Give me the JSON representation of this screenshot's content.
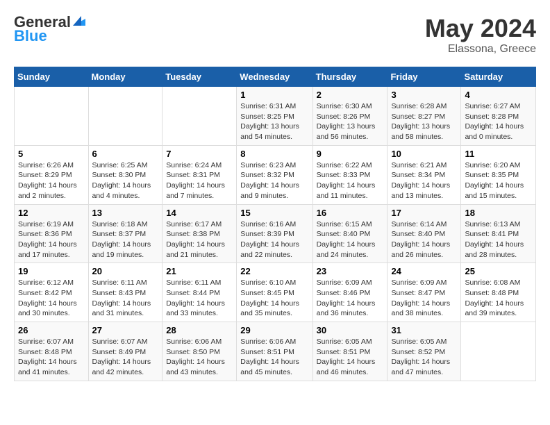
{
  "header": {
    "logo_line1": "General",
    "logo_line2": "Blue",
    "month": "May 2024",
    "location": "Elassona, Greece"
  },
  "weekdays": [
    "Sunday",
    "Monday",
    "Tuesday",
    "Wednesday",
    "Thursday",
    "Friday",
    "Saturday"
  ],
  "weeks": [
    [
      {
        "day": "",
        "info": ""
      },
      {
        "day": "",
        "info": ""
      },
      {
        "day": "",
        "info": ""
      },
      {
        "day": "1",
        "info": "Sunrise: 6:31 AM\nSunset: 8:25 PM\nDaylight: 13 hours\nand 54 minutes."
      },
      {
        "day": "2",
        "info": "Sunrise: 6:30 AM\nSunset: 8:26 PM\nDaylight: 13 hours\nand 56 minutes."
      },
      {
        "day": "3",
        "info": "Sunrise: 6:28 AM\nSunset: 8:27 PM\nDaylight: 13 hours\nand 58 minutes."
      },
      {
        "day": "4",
        "info": "Sunrise: 6:27 AM\nSunset: 8:28 PM\nDaylight: 14 hours\nand 0 minutes."
      }
    ],
    [
      {
        "day": "5",
        "info": "Sunrise: 6:26 AM\nSunset: 8:29 PM\nDaylight: 14 hours\nand 2 minutes."
      },
      {
        "day": "6",
        "info": "Sunrise: 6:25 AM\nSunset: 8:30 PM\nDaylight: 14 hours\nand 4 minutes."
      },
      {
        "day": "7",
        "info": "Sunrise: 6:24 AM\nSunset: 8:31 PM\nDaylight: 14 hours\nand 7 minutes."
      },
      {
        "day": "8",
        "info": "Sunrise: 6:23 AM\nSunset: 8:32 PM\nDaylight: 14 hours\nand 9 minutes."
      },
      {
        "day": "9",
        "info": "Sunrise: 6:22 AM\nSunset: 8:33 PM\nDaylight: 14 hours\nand 11 minutes."
      },
      {
        "day": "10",
        "info": "Sunrise: 6:21 AM\nSunset: 8:34 PM\nDaylight: 14 hours\nand 13 minutes."
      },
      {
        "day": "11",
        "info": "Sunrise: 6:20 AM\nSunset: 8:35 PM\nDaylight: 14 hours\nand 15 minutes."
      }
    ],
    [
      {
        "day": "12",
        "info": "Sunrise: 6:19 AM\nSunset: 8:36 PM\nDaylight: 14 hours\nand 17 minutes."
      },
      {
        "day": "13",
        "info": "Sunrise: 6:18 AM\nSunset: 8:37 PM\nDaylight: 14 hours\nand 19 minutes."
      },
      {
        "day": "14",
        "info": "Sunrise: 6:17 AM\nSunset: 8:38 PM\nDaylight: 14 hours\nand 21 minutes."
      },
      {
        "day": "15",
        "info": "Sunrise: 6:16 AM\nSunset: 8:39 PM\nDaylight: 14 hours\nand 22 minutes."
      },
      {
        "day": "16",
        "info": "Sunrise: 6:15 AM\nSunset: 8:40 PM\nDaylight: 14 hours\nand 24 minutes."
      },
      {
        "day": "17",
        "info": "Sunrise: 6:14 AM\nSunset: 8:40 PM\nDaylight: 14 hours\nand 26 minutes."
      },
      {
        "day": "18",
        "info": "Sunrise: 6:13 AM\nSunset: 8:41 PM\nDaylight: 14 hours\nand 28 minutes."
      }
    ],
    [
      {
        "day": "19",
        "info": "Sunrise: 6:12 AM\nSunset: 8:42 PM\nDaylight: 14 hours\nand 30 minutes."
      },
      {
        "day": "20",
        "info": "Sunrise: 6:11 AM\nSunset: 8:43 PM\nDaylight: 14 hours\nand 31 minutes."
      },
      {
        "day": "21",
        "info": "Sunrise: 6:11 AM\nSunset: 8:44 PM\nDaylight: 14 hours\nand 33 minutes."
      },
      {
        "day": "22",
        "info": "Sunrise: 6:10 AM\nSunset: 8:45 PM\nDaylight: 14 hours\nand 35 minutes."
      },
      {
        "day": "23",
        "info": "Sunrise: 6:09 AM\nSunset: 8:46 PM\nDaylight: 14 hours\nand 36 minutes."
      },
      {
        "day": "24",
        "info": "Sunrise: 6:09 AM\nSunset: 8:47 PM\nDaylight: 14 hours\nand 38 minutes."
      },
      {
        "day": "25",
        "info": "Sunrise: 6:08 AM\nSunset: 8:48 PM\nDaylight: 14 hours\nand 39 minutes."
      }
    ],
    [
      {
        "day": "26",
        "info": "Sunrise: 6:07 AM\nSunset: 8:48 PM\nDaylight: 14 hours\nand 41 minutes."
      },
      {
        "day": "27",
        "info": "Sunrise: 6:07 AM\nSunset: 8:49 PM\nDaylight: 14 hours\nand 42 minutes."
      },
      {
        "day": "28",
        "info": "Sunrise: 6:06 AM\nSunset: 8:50 PM\nDaylight: 14 hours\nand 43 minutes."
      },
      {
        "day": "29",
        "info": "Sunrise: 6:06 AM\nSunset: 8:51 PM\nDaylight: 14 hours\nand 45 minutes."
      },
      {
        "day": "30",
        "info": "Sunrise: 6:05 AM\nSunset: 8:51 PM\nDaylight: 14 hours\nand 46 minutes."
      },
      {
        "day": "31",
        "info": "Sunrise: 6:05 AM\nSunset: 8:52 PM\nDaylight: 14 hours\nand 47 minutes."
      },
      {
        "day": "",
        "info": ""
      }
    ]
  ]
}
